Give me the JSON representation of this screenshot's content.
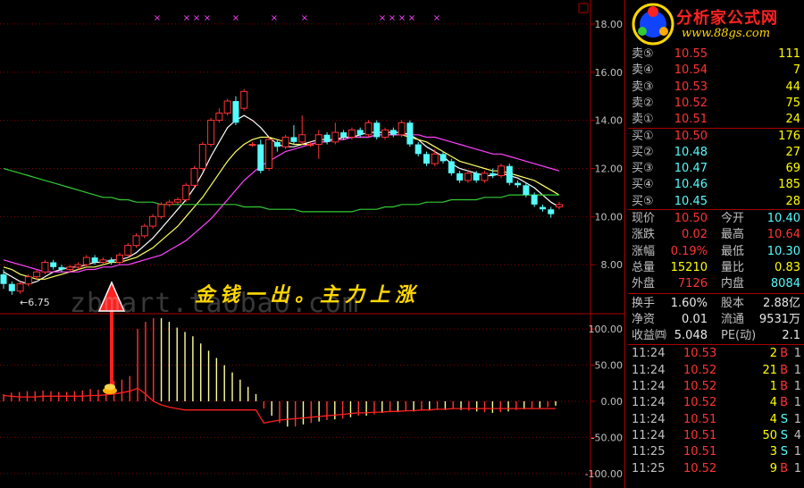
{
  "brand": {
    "title": "分析家公式网",
    "url": "www.88gs.com"
  },
  "overlay": {
    "slogan": "金钱一出。主力上涨",
    "watermark": "zbmart.taobao.com",
    "low_marker": "←6.75"
  },
  "chart_data": [
    {
      "type": "candlestick",
      "panel": "price",
      "y_ticks": [
        "18.00",
        "16.00",
        "14.00",
        "12.00",
        "10.00",
        "8.00"
      ],
      "ylim": [
        6.0,
        19.0
      ],
      "low_label": "6.75",
      "candles": [
        {
          "o": 7.6,
          "c": 7.2,
          "h": 7.8,
          "l": 7.0
        },
        {
          "o": 7.2,
          "c": 6.9,
          "h": 7.3,
          "l": 6.75
        },
        {
          "o": 6.9,
          "c": 7.2,
          "h": 7.3,
          "l": 6.8
        },
        {
          "o": 7.2,
          "c": 7.5,
          "h": 7.6,
          "l": 7.1
        },
        {
          "o": 7.5,
          "c": 7.7,
          "h": 7.8,
          "l": 7.4
        },
        {
          "o": 7.7,
          "c": 8.1,
          "h": 8.2,
          "l": 7.6
        },
        {
          "o": 8.1,
          "c": 7.9,
          "h": 8.2,
          "l": 7.8
        },
        {
          "o": 7.9,
          "c": 7.8,
          "h": 8.0,
          "l": 7.7
        },
        {
          "o": 7.8,
          "c": 7.9,
          "h": 8.0,
          "l": 7.7
        },
        {
          "o": 7.9,
          "c": 8.0,
          "h": 8.1,
          "l": 7.8
        },
        {
          "o": 8.0,
          "c": 8.3,
          "h": 8.4,
          "l": 7.9
        },
        {
          "o": 8.3,
          "c": 8.1,
          "h": 8.4,
          "l": 8.0
        },
        {
          "o": 8.1,
          "c": 8.2,
          "h": 8.3,
          "l": 8.0
        },
        {
          "o": 8.2,
          "c": 8.1,
          "h": 8.3,
          "l": 8.0
        },
        {
          "o": 8.1,
          "c": 8.4,
          "h": 8.5,
          "l": 8.0
        },
        {
          "o": 8.4,
          "c": 8.8,
          "h": 8.9,
          "l": 8.3
        },
        {
          "o": 8.8,
          "c": 9.2,
          "h": 9.3,
          "l": 8.7
        },
        {
          "o": 9.2,
          "c": 9.6,
          "h": 9.7,
          "l": 9.1
        },
        {
          "o": 9.6,
          "c": 10.0,
          "h": 10.1,
          "l": 9.5
        },
        {
          "o": 10.0,
          "c": 10.5,
          "h": 10.6,
          "l": 9.9
        },
        {
          "o": 10.5,
          "c": 10.6,
          "h": 10.7,
          "l": 10.4
        },
        {
          "o": 10.6,
          "c": 10.7,
          "h": 10.8,
          "l": 10.5
        },
        {
          "o": 10.7,
          "c": 11.3,
          "h": 11.4,
          "l": 10.6
        },
        {
          "o": 11.3,
          "c": 12.0,
          "h": 12.1,
          "l": 11.2
        },
        {
          "o": 12.0,
          "c": 13.0,
          "h": 13.1,
          "l": 11.9
        },
        {
          "o": 13.0,
          "c": 14.0,
          "h": 14.1,
          "l": 12.9
        },
        {
          "o": 14.0,
          "c": 14.3,
          "h": 14.5,
          "l": 13.9
        },
        {
          "o": 14.3,
          "c": 14.8,
          "h": 14.9,
          "l": 14.2
        },
        {
          "o": 14.8,
          "c": 13.9,
          "h": 15.0,
          "l": 13.8
        },
        {
          "o": 14.5,
          "c": 15.2,
          "h": 15.3,
          "l": 14.4
        },
        {
          "o": 13.0,
          "c": 13.0,
          "h": 13.1,
          "l": 12.9
        },
        {
          "o": 13.0,
          "c": 11.9,
          "h": 13.2,
          "l": 11.8
        },
        {
          "o": 12.0,
          "c": 13.2,
          "h": 13.3,
          "l": 11.9
        },
        {
          "o": 13.1,
          "c": 12.9,
          "h": 13.2,
          "l": 12.7
        },
        {
          "o": 12.9,
          "c": 13.3,
          "h": 13.4,
          "l": 12.8
        },
        {
          "o": 13.3,
          "c": 13.1,
          "h": 13.8,
          "l": 13.0
        },
        {
          "o": 13.1,
          "c": 13.4,
          "h": 14.2,
          "l": 13.0
        },
        {
          "o": 13.0,
          "c": 13.0,
          "h": 13.1,
          "l": 12.9
        },
        {
          "o": 13.0,
          "c": 13.4,
          "h": 13.6,
          "l": 12.4
        },
        {
          "o": 13.4,
          "c": 13.1,
          "h": 13.5,
          "l": 13.0
        },
        {
          "o": 13.1,
          "c": 13.5,
          "h": 13.9,
          "l": 13.0
        },
        {
          "o": 13.5,
          "c": 13.3,
          "h": 13.6,
          "l": 13.2
        },
        {
          "o": 13.3,
          "c": 13.6,
          "h": 13.7,
          "l": 13.2
        },
        {
          "o": 13.6,
          "c": 13.4,
          "h": 13.7,
          "l": 13.3
        },
        {
          "o": 13.4,
          "c": 13.9,
          "h": 14.0,
          "l": 13.3
        },
        {
          "o": 13.9,
          "c": 13.3,
          "h": 14.0,
          "l": 13.2
        },
        {
          "o": 13.3,
          "c": 13.6,
          "h": 13.7,
          "l": 13.2
        },
        {
          "o": 13.6,
          "c": 13.4,
          "h": 13.7,
          "l": 13.3
        },
        {
          "o": 13.4,
          "c": 13.9,
          "h": 14.0,
          "l": 13.3
        },
        {
          "o": 13.9,
          "c": 13.0,
          "h": 14.0,
          "l": 12.9
        },
        {
          "o": 13.0,
          "c": 12.6,
          "h": 13.1,
          "l": 12.5
        },
        {
          "o": 12.6,
          "c": 12.2,
          "h": 12.7,
          "l": 12.1
        },
        {
          "o": 12.2,
          "c": 12.6,
          "h": 12.8,
          "l": 12.1
        },
        {
          "o": 12.6,
          "c": 12.3,
          "h": 12.7,
          "l": 12.2
        },
        {
          "o": 12.3,
          "c": 11.8,
          "h": 12.4,
          "l": 11.7
        },
        {
          "o": 11.8,
          "c": 11.5,
          "h": 11.9,
          "l": 11.4
        },
        {
          "o": 11.5,
          "c": 11.8,
          "h": 11.9,
          "l": 11.4
        },
        {
          "o": 11.8,
          "c": 11.5,
          "h": 11.9,
          "l": 11.4
        },
        {
          "o": 11.5,
          "c": 11.8,
          "h": 11.9,
          "l": 11.4
        },
        {
          "o": 11.8,
          "c": 11.7,
          "h": 12.0,
          "l": 11.6
        },
        {
          "o": 11.7,
          "c": 12.1,
          "h": 12.2,
          "l": 11.6
        },
        {
          "o": 12.1,
          "c": 11.4,
          "h": 12.2,
          "l": 11.3
        },
        {
          "o": 11.4,
          "c": 11.3,
          "h": 11.5,
          "l": 11.2
        },
        {
          "o": 11.3,
          "c": 10.9,
          "h": 11.4,
          "l": 10.8
        },
        {
          "o": 10.9,
          "c": 10.5,
          "h": 11.0,
          "l": 10.4
        },
        {
          "o": 10.4,
          "c": 10.3,
          "h": 10.5,
          "l": 10.2
        },
        {
          "o": 10.3,
          "c": 10.1,
          "h": 10.4,
          "l": 9.95
        },
        {
          "o": 10.4,
          "c": 10.5,
          "h": 10.6,
          "l": 10.3
        }
      ],
      "ma_series": [
        {
          "color": "#ffffff",
          "values": [
            7.7,
            7.5,
            7.3,
            7.2,
            7.3,
            7.5,
            7.7,
            7.8,
            7.9,
            7.9,
            8.0,
            8.1,
            8.1,
            8.2,
            8.2,
            8.3,
            8.5,
            8.8,
            9.1,
            9.5,
            9.9,
            10.3,
            10.7,
            11.2,
            11.8,
            12.5,
            13.1,
            13.7,
            14.0,
            14.2,
            14.0,
            13.7,
            13.3,
            13.0,
            12.9,
            12.9,
            13.0,
            13.1,
            13.2,
            13.2,
            13.2,
            13.3,
            13.3,
            13.4,
            13.5,
            13.5,
            13.5,
            13.5,
            13.5,
            13.4,
            13.2,
            12.9,
            12.7,
            12.5,
            12.2,
            12.0,
            11.9,
            11.8,
            11.7,
            11.7,
            11.8,
            11.7,
            11.6,
            11.4,
            11.2,
            10.9,
            10.6,
            10.4
          ]
        },
        {
          "color": "#ffff66",
          "values": [
            7.9,
            7.8,
            7.6,
            7.5,
            7.4,
            7.4,
            7.5,
            7.6,
            7.7,
            7.8,
            7.9,
            7.9,
            8.0,
            8.1,
            8.1,
            8.2,
            8.3,
            8.5,
            8.7,
            9.0,
            9.3,
            9.6,
            10.0,
            10.4,
            10.8,
            11.3,
            11.8,
            12.3,
            12.7,
            13.0,
            13.2,
            13.3,
            13.3,
            13.2,
            13.1,
            13.0,
            13.0,
            13.0,
            13.1,
            13.1,
            13.2,
            13.2,
            13.3,
            13.3,
            13.3,
            13.4,
            13.4,
            13.4,
            13.4,
            13.3,
            13.2,
            13.1,
            12.9,
            12.7,
            12.5,
            12.3,
            12.2,
            12.1,
            12.0,
            11.9,
            11.9,
            11.8,
            11.7,
            11.6,
            11.5,
            11.3,
            11.1,
            10.9
          ]
        },
        {
          "color": "#ff44ff",
          "values": [
            8.2,
            8.1,
            8.0,
            7.9,
            7.8,
            7.7,
            7.7,
            7.7,
            7.7,
            7.7,
            7.8,
            7.8,
            7.9,
            7.9,
            8.0,
            8.0,
            8.1,
            8.2,
            8.3,
            8.4,
            8.6,
            8.8,
            9.0,
            9.3,
            9.6,
            9.9,
            10.3,
            10.7,
            11.1,
            11.5,
            11.8,
            12.1,
            12.3,
            12.5,
            12.7,
            12.8,
            12.9,
            13.0,
            13.1,
            13.1,
            13.2,
            13.2,
            13.3,
            13.3,
            13.3,
            13.4,
            13.4,
            13.4,
            13.4,
            13.4,
            13.4,
            13.3,
            13.3,
            13.2,
            13.1,
            13.0,
            12.9,
            12.8,
            12.7,
            12.6,
            12.6,
            12.5,
            12.4,
            12.3,
            12.2,
            12.1,
            12.0,
            11.9
          ]
        },
        {
          "color": "#33cc33",
          "values": [
            12.0,
            11.9,
            11.8,
            11.7,
            11.6,
            11.5,
            11.4,
            11.3,
            11.2,
            11.1,
            11.0,
            10.9,
            10.8,
            10.8,
            10.7,
            10.7,
            10.6,
            10.6,
            10.6,
            10.5,
            10.5,
            10.5,
            10.5,
            10.5,
            10.5,
            10.5,
            10.5,
            10.5,
            10.5,
            10.4,
            10.4,
            10.4,
            10.3,
            10.3,
            10.3,
            10.3,
            10.2,
            10.2,
            10.2,
            10.2,
            10.2,
            10.2,
            10.2,
            10.3,
            10.3,
            10.3,
            10.4,
            10.4,
            10.5,
            10.5,
            10.5,
            10.6,
            10.6,
            10.6,
            10.7,
            10.7,
            10.7,
            10.7,
            10.8,
            10.8,
            10.8,
            10.9,
            10.9,
            10.9,
            10.9,
            10.9,
            10.9,
            10.9
          ]
        }
      ]
    },
    {
      "type": "bar",
      "panel": "indicator",
      "y_ticks": [
        "100.00",
        "50.00",
        "0.00",
        "-50.00",
        "-100.00"
      ],
      "ylim": [
        -120,
        120
      ],
      "values": [
        10,
        12,
        13,
        14,
        14,
        15,
        14,
        13,
        13,
        14,
        15,
        17,
        16,
        22,
        28,
        30,
        35,
        100,
        110,
        115,
        115,
        110,
        102,
        96,
        90,
        80,
        70,
        60,
        50,
        40,
        30,
        20,
        10,
        -10,
        -20,
        -30,
        -35,
        -35,
        -32,
        -30,
        -28,
        -26,
        -25,
        -24,
        -22,
        -20,
        -20,
        -18,
        -16,
        -15,
        -15,
        -14,
        -14,
        -13,
        -13,
        -12,
        -12,
        -11,
        -12,
        -13,
        -14,
        -15,
        -16,
        -15,
        -14,
        -12,
        -11,
        -10,
        -9,
        -8,
        -6
      ],
      "line": [
        8,
        7,
        6,
        6,
        6,
        7,
        7,
        7,
        7,
        7,
        7,
        8,
        8,
        9,
        10,
        12,
        14,
        18,
        10,
        0,
        -5,
        -8,
        -10,
        -12,
        -12,
        -12,
        -12,
        -12,
        -12,
        -12,
        -12,
        -12,
        -12,
        -30,
        -28,
        -26,
        -25,
        -24,
        -23,
        -22,
        -21,
        -20,
        -19,
        -18,
        -17,
        -16,
        -16,
        -15,
        -15,
        -14,
        -14,
        -13,
        -13,
        -12,
        -12,
        -11,
        -11,
        -10,
        -10,
        -10,
        -10,
        -10,
        -10,
        -10,
        -10,
        -10,
        -10,
        -10,
        -10,
        -10,
        -10
      ]
    }
  ],
  "quote": {
    "sell": [
      {
        "label": "卖⑤",
        "price": "10.55",
        "vol": "111"
      },
      {
        "label": "卖④",
        "price": "10.54",
        "vol": "7"
      },
      {
        "label": "卖③",
        "price": "10.53",
        "vol": "44"
      },
      {
        "label": "卖②",
        "price": "10.52",
        "vol": "75"
      },
      {
        "label": "卖①",
        "price": "10.51",
        "vol": "24"
      }
    ],
    "buy": [
      {
        "label": "买①",
        "price": "10.50",
        "vol": "176"
      },
      {
        "label": "买②",
        "price": "10.48",
        "vol": "27"
      },
      {
        "label": "买③",
        "price": "10.47",
        "vol": "69"
      },
      {
        "label": "买④",
        "price": "10.46",
        "vol": "185"
      },
      {
        "label": "买⑤",
        "price": "10.45",
        "vol": "28"
      }
    ],
    "stats": [
      {
        "l1": "现价",
        "v1": "10.50",
        "c1": "red",
        "l2": "今开",
        "v2": "10.40",
        "c2": "cyan"
      },
      {
        "l1": "涨跌",
        "v1": "0.02",
        "c1": "red",
        "l2": "最高",
        "v2": "10.64",
        "c2": "red"
      },
      {
        "l1": "涨幅",
        "v1": "0.19%",
        "c1": "red",
        "l2": "最低",
        "v2": "10.30",
        "c2": "cyan"
      },
      {
        "l1": "总量",
        "v1": "15210",
        "c1": "yellow",
        "l2": "量比",
        "v2": "0.83",
        "c2": "yellow"
      },
      {
        "l1": "外盘",
        "v1": "7126",
        "c1": "red",
        "l2": "内盘",
        "v2": "8084",
        "c2": "cyan"
      }
    ],
    "info": [
      {
        "l1": "换手",
        "v1": "1.60%",
        "l2": "股本",
        "v2": "2.88亿"
      },
      {
        "l1": "净资",
        "v1": "0.01",
        "l2": "流通",
        "v2": "9531万"
      },
      {
        "l1": "收益㈣",
        "v1": "5.048",
        "l2": "PE(动)",
        "v2": "2.1"
      }
    ],
    "ticks": [
      {
        "time": "11:24",
        "price": "10.53",
        "vol": "2",
        "bs": "B",
        "cnt": "1"
      },
      {
        "time": "11:24",
        "price": "10.52",
        "vol": "21",
        "bs": "B",
        "cnt": "1"
      },
      {
        "time": "11:24",
        "price": "10.52",
        "vol": "1",
        "bs": "B",
        "cnt": "1"
      },
      {
        "time": "11:24",
        "price": "10.52",
        "vol": "4",
        "bs": "B",
        "cnt": "1"
      },
      {
        "time": "11:24",
        "price": "10.51",
        "vol": "4",
        "bs": "S",
        "cnt": "1"
      },
      {
        "time": "11:24",
        "price": "10.51",
        "vol": "50",
        "bs": "S",
        "cnt": "4"
      },
      {
        "time": "11:25",
        "price": "10.51",
        "vol": "3",
        "bs": "S",
        "cnt": "1"
      },
      {
        "time": "11:25",
        "price": "10.52",
        "vol": "9",
        "bs": "B",
        "cnt": "1"
      }
    ]
  },
  "colors": {
    "up": "#ff3333",
    "down": "#54fcfc",
    "grid": "#aa0000",
    "axis_text": "#c0c0c0",
    "gold": "#ffd700",
    "pink": "#ff44ff",
    "bar_up_early": "#ff3333",
    "bar_up_late": "#ffff99"
  }
}
